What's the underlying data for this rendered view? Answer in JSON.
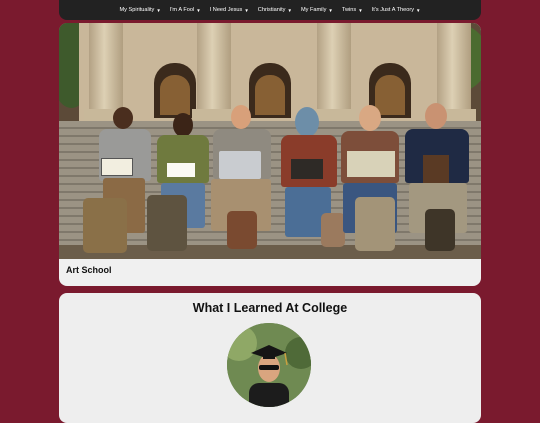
{
  "nav": {
    "items": [
      {
        "label": "My Spirituality"
      },
      {
        "label": "I'm A Fool"
      },
      {
        "label": "I Need Jesus"
      },
      {
        "label": "Christianity"
      },
      {
        "label": "My Family"
      },
      {
        "label": "Twins"
      },
      {
        "label": "It's Just A Theory"
      }
    ],
    "caret_icon": "caret-down-icon"
  },
  "cards": [
    {
      "title": "Art School",
      "image": "students-on-campus-steps-photo"
    },
    {
      "title": "What I Learned At College",
      "image": "graduate-in-cap-avatar"
    }
  ],
  "colors": {
    "background": "#7a1a2e",
    "navbar": "#222222",
    "card": "#f0f0f0"
  }
}
